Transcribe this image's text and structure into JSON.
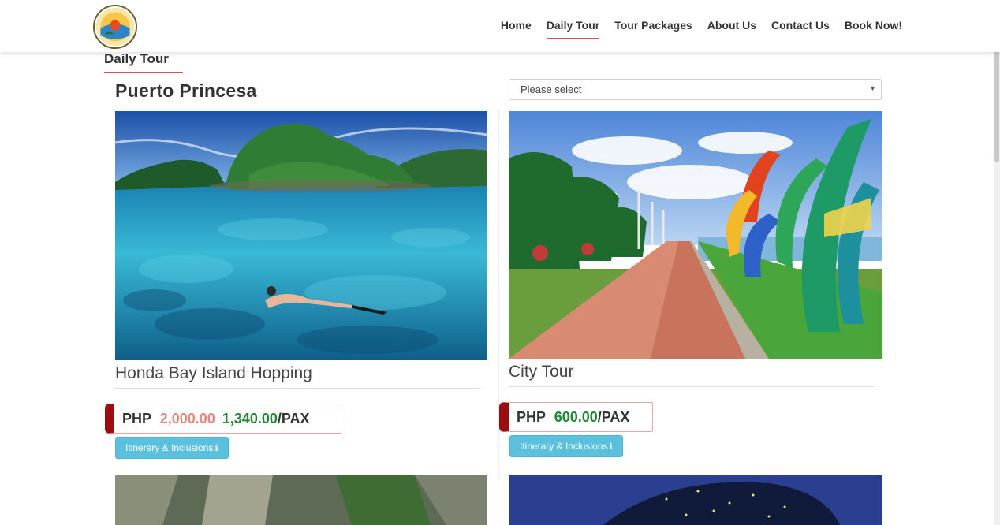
{
  "nav": {
    "items": [
      {
        "label": "Home",
        "active": false
      },
      {
        "label": "Daily Tour",
        "active": true
      },
      {
        "label": "Tour Packages",
        "active": false
      },
      {
        "label": "About Us",
        "active": false
      },
      {
        "label": "Contact Us",
        "active": false
      },
      {
        "label": "Book Now!",
        "active": false
      }
    ]
  },
  "page": {
    "section_title": "Daily Tour",
    "city": "Puerto Princesa",
    "select_placeholder": "Please select"
  },
  "tours": [
    {
      "name": "Honda Bay Island Hopping",
      "currency": "PHP",
      "old_price": "2,000.00",
      "price": "1,340.00",
      "unit": "/PAX",
      "button": "Itinerary & Inclusions",
      "image_icon": "island-snorkel-image"
    },
    {
      "name": "City Tour",
      "currency": "PHP",
      "old_price": "",
      "price": "600.00",
      "unit": "/PAX",
      "button": "Itinerary & Inclusions",
      "image_icon": "baywalk-image"
    }
  ],
  "colors": {
    "accent_red": "#d9534f",
    "price_tab": "#9b0d12",
    "price_green": "#1c8a2e",
    "button_info": "#5bc0de"
  }
}
